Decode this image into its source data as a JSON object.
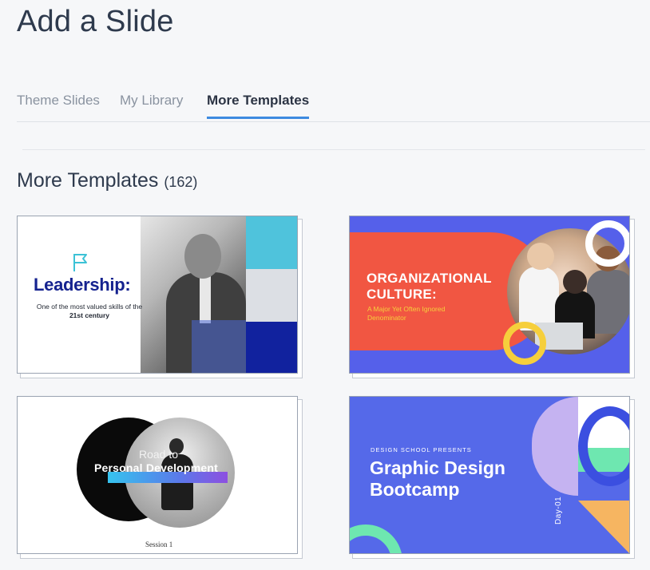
{
  "page": {
    "title": "Add a Slide"
  },
  "tabs": [
    {
      "label": "Theme Slides",
      "active": false
    },
    {
      "label": "My Library",
      "active": false
    },
    {
      "label": "More Templates",
      "active": true
    }
  ],
  "section": {
    "title": "More Templates",
    "count": "(162)"
  },
  "templates": [
    {
      "title": "Leadership:",
      "subtitle_pre": "One of the most valued skills of the ",
      "subtitle_bold": "21st century",
      "icon": "flag-icon"
    },
    {
      "title_line1": "ORGANIZATIONAL",
      "title_line2": "CULTURE:",
      "subtitle_line1": "A Major Yet Often Ignored",
      "subtitle_line2": "Denominator"
    },
    {
      "title_line1": "Road to",
      "title_line2": "Personal Development",
      "footer": "Session 1"
    },
    {
      "kicker": "DESIGN SCHOOL PRESENTS",
      "title_line1": "Graphic Design",
      "title_line2": "Bootcamp",
      "day": "Day-01"
    }
  ],
  "colors": {
    "tab_active_underline": "#3d8ae0",
    "leadership_blue": "#15228f",
    "org_red": "#f15642",
    "org_purple": "#5560ea",
    "bootcamp_blue": "#5569e9",
    "accent_green": "#6ee7b0"
  }
}
